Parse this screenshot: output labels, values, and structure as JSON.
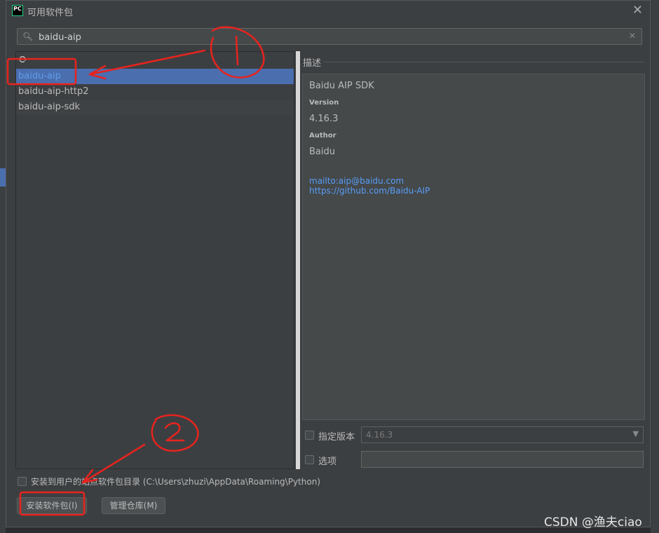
{
  "window": {
    "title": "可用软件包"
  },
  "search": {
    "value": "baidu-aip"
  },
  "packages": [
    {
      "name": "baidu-aip"
    },
    {
      "name": "baidu-aip-http2"
    },
    {
      "name": "baidu-aip-sdk"
    }
  ],
  "description": {
    "label": "描述",
    "name": "Baidu AIP SDK",
    "version_heading": "Version",
    "version": "4.16.3",
    "author_heading": "Author",
    "author": "Baidu",
    "links": [
      "mailto:aip@baidu.com",
      "https://github.com/Baidu-AIP"
    ]
  },
  "options": {
    "specify_version_label": "指定版本",
    "version_value": "4.16.3",
    "options_label": "选项"
  },
  "install_user_site": {
    "label": "安装到用户的站点软件包目录 (C:\\Users\\zhuzi\\AppData\\Roaming\\Python)"
  },
  "buttons": {
    "install": "安装软件包(I)",
    "manage_repos": "管理仓库(M)"
  },
  "annotations": [
    "1",
    "2"
  ],
  "watermark": "CSDN @渔夫ciao",
  "colors": {
    "accent": "#4b6eaf",
    "link": "#589df6",
    "annotation": "#e8231e"
  }
}
